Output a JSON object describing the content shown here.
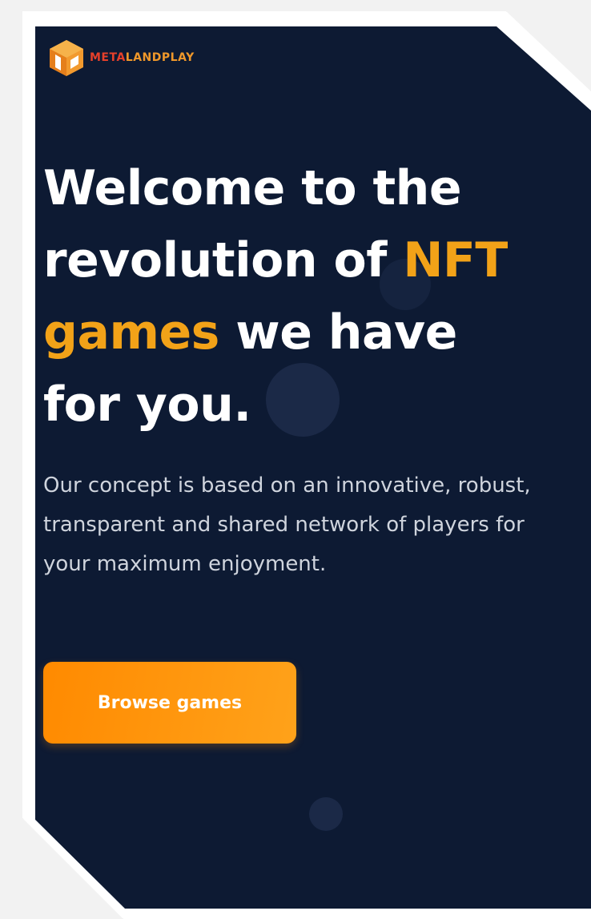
{
  "logo": {
    "icon": "meta-land-cube-icon",
    "text_meta": "META",
    "text_land": "LAND",
    "text_play": "PLAY"
  },
  "hero": {
    "headline_part1": "Welcome to the revolution of ",
    "headline_highlight": "NFT games",
    "headline_part2": " we have for you.",
    "description": "Our concept is based on an innovative, robust, transparent and shared network of players for your maximum enjoyment.",
    "cta_label": "Browse games"
  },
  "colors": {
    "background": "#0d1a33",
    "accent": "#f2a218",
    "button": "#ff8a00",
    "text": "#ffffff"
  }
}
